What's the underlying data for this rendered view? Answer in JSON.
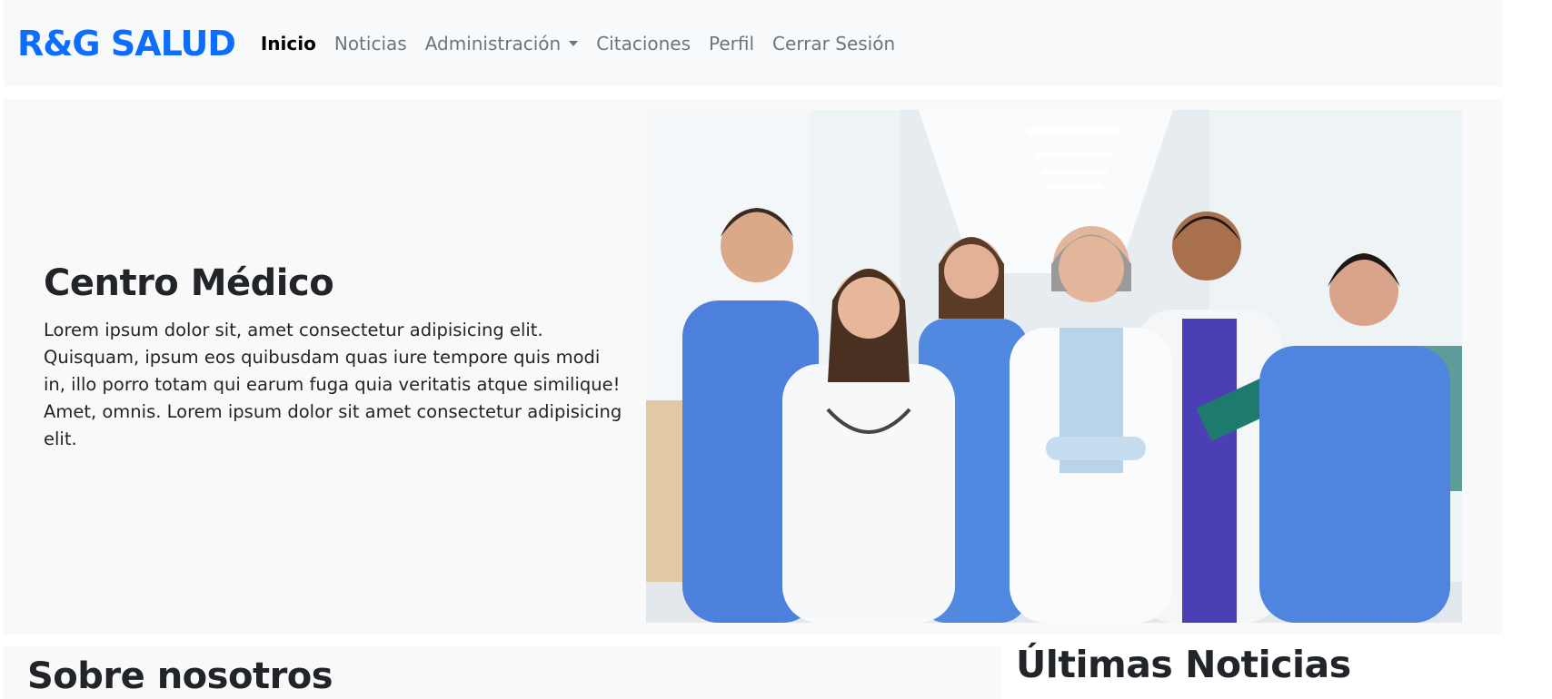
{
  "navbar": {
    "brand": "R&G SALUD",
    "links": [
      {
        "label": "Inicio",
        "active": true
      },
      {
        "label": "Noticias"
      },
      {
        "label": "Administración",
        "dropdown": true
      },
      {
        "label": "Citaciones"
      },
      {
        "label": "Perfil"
      },
      {
        "label": "Cerrar Sesión"
      }
    ]
  },
  "hero": {
    "title": "Centro Médico",
    "body": "Lorem ipsum dolor sit, amet consectetur adipisicing elit. Quisquam, ipsum eos quibusdam quas iure tempore quis modi in, illo porro totam qui earum fuga quia veritatis atque similique! Amet, omnis. Lorem ipsum dolor sit amet consectetur adipisicing elit.",
    "image_alt": "medical-team-photo"
  },
  "about": {
    "title": "Sobre nosotros"
  },
  "news": {
    "title": "Últimas Noticias"
  },
  "colors": {
    "brand": "#0d6efd",
    "navbar_bg": "#f8f9fa",
    "nav_muted": "#6c757d",
    "scrubs": "#4d7fdc",
    "coat": "#f7f8fa"
  }
}
